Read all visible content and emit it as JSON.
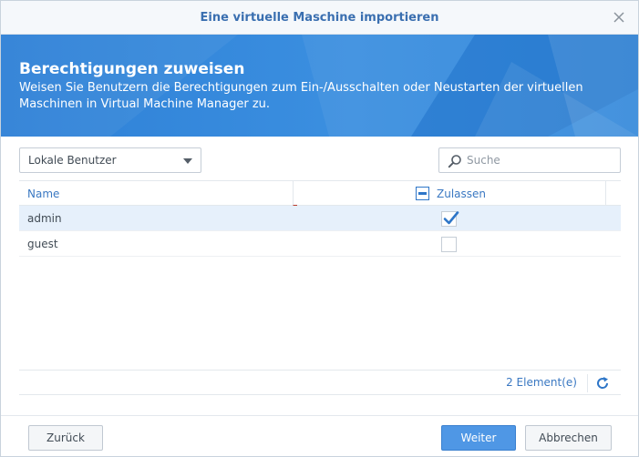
{
  "window": {
    "title": "Eine virtuelle Maschine importieren"
  },
  "banner": {
    "heading": "Berechtigungen zuweisen",
    "description": "Weisen Sie Benutzern die Berechtigungen zum Ein-/Ausschalten oder Neustarten der virtuellen Maschinen in Virtual Machine Manager zu."
  },
  "filter": {
    "selected": "Lokale Benutzer"
  },
  "search": {
    "placeholder": "Suche",
    "value": ""
  },
  "grid": {
    "columns": {
      "name": "Name",
      "allow": "Zulassen"
    },
    "rows": [
      {
        "name": "admin",
        "allowed": true,
        "selected": true
      },
      {
        "name": "guest",
        "allowed": false,
        "selected": false
      }
    ],
    "count_label": "2 Element(e)"
  },
  "buttons": {
    "back": "Zurück",
    "next": "Weiter",
    "cancel": "Abbrechen"
  },
  "icons": {
    "close": "close-icon",
    "search": "search-icon",
    "dropdown": "chevron-down-icon",
    "refresh": "refresh-icon",
    "check": "check-icon"
  },
  "colors": {
    "accent": "#2e80d6",
    "link": "#3a78c2",
    "primary_button": "#4f97e5",
    "row_selected": "#e6f0fb"
  }
}
